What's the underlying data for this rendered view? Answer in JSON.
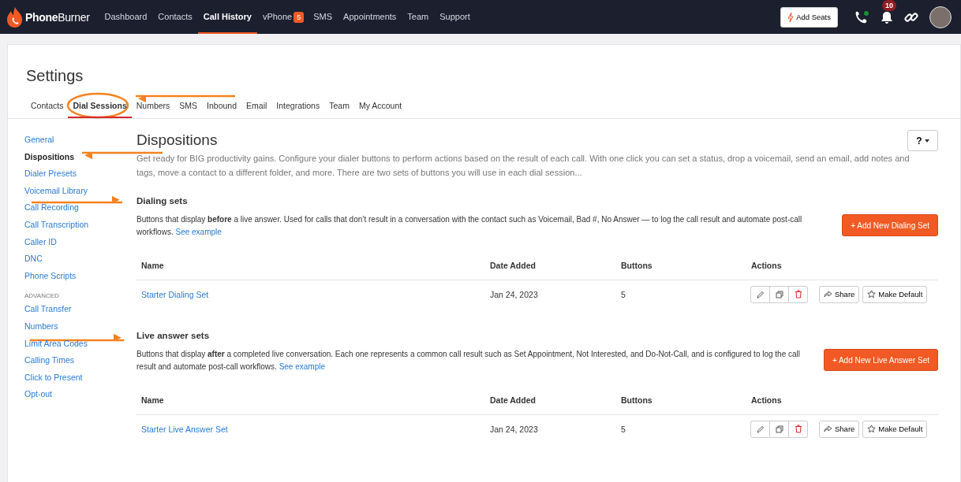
{
  "nav": {
    "logo": {
      "bold": "Phone",
      "light": "Burner"
    },
    "items": [
      {
        "label": "Dashboard",
        "selected": false
      },
      {
        "label": "Contacts",
        "selected": false
      },
      {
        "label": "Call History",
        "selected": true
      },
      {
        "label": "vPhone",
        "selected": false,
        "badge": "5"
      },
      {
        "label": "SMS",
        "selected": false
      },
      {
        "label": "Appointments",
        "selected": false
      },
      {
        "label": "Team",
        "selected": false
      },
      {
        "label": "Support",
        "selected": false
      }
    ],
    "add_seats": "Add Seats",
    "notifications": "10"
  },
  "settings": {
    "title": "Settings",
    "tabs": [
      {
        "label": "Contacts",
        "selected": false
      },
      {
        "label": "Dial Sessions",
        "selected": true
      },
      {
        "label": "Numbers",
        "selected": false
      },
      {
        "label": "SMS",
        "selected": false
      },
      {
        "label": "Inbound",
        "selected": false
      },
      {
        "label": "Email",
        "selected": false
      },
      {
        "label": "Integrations",
        "selected": false
      },
      {
        "label": "Team",
        "selected": false
      },
      {
        "label": "My Account",
        "selected": false
      }
    ]
  },
  "sidebar": {
    "groups": [
      {
        "items": [
          {
            "label": "General",
            "selected": false
          },
          {
            "label": "Dispositions",
            "selected": true
          },
          {
            "label": "Dialer Presets",
            "selected": false
          },
          {
            "label": "Voicemail Library",
            "selected": false
          },
          {
            "label": "Call Recording",
            "selected": false
          },
          {
            "label": "Call Transcription",
            "selected": false
          },
          {
            "label": "Caller ID",
            "selected": false
          },
          {
            "label": "DNC",
            "selected": false
          },
          {
            "label": "Phone Scripts",
            "selected": false
          }
        ]
      },
      {
        "heading": "ADVANCED",
        "items": [
          {
            "label": "Call Transfer",
            "selected": false
          },
          {
            "label": "Numbers",
            "selected": false
          },
          {
            "label": "Limit Area Codes",
            "selected": false
          },
          {
            "label": "Calling Times",
            "selected": false
          },
          {
            "label": "Click to Present",
            "selected": false
          },
          {
            "label": "Opt-out",
            "selected": false
          }
        ]
      }
    ]
  },
  "content": {
    "title": "Dispositions",
    "help": "?",
    "intro": "Get ready for BIG productivity gains. Configure your dialer buttons to perform actions based on the result of each call. With one click you can set a status, drop a voicemail, send an email, add notes and tags, move a contact to a different folder, and more. There are two sets of buttons you will use in each dial session...",
    "sections": [
      {
        "title": "Dialing sets",
        "description": "Buttons that display **before** a live answer. Used for calls that don’t result in a conversation with the contact such as Voicemail, Bad #, No Answer — to log the call result and automate post-call workflows.",
        "link": "See example",
        "button": "+ Add New Dialing Set",
        "columns": [
          "Name",
          "Date Added",
          "Buttons",
          "Actions"
        ],
        "rows": [
          {
            "name": "Starter Dialing Set",
            "date": "Jan 24, 2023",
            "buttons": "5",
            "share": "Share",
            "make_default": "Make Default"
          }
        ]
      },
      {
        "title": "Live answer sets",
        "description": "Buttons that display **after** a completed live conversation. Each one represents a common call result such as Set Appointment, Not Interested, and Do-Not-Call, and is configured to log the call result and automate post-call workflows.",
        "link": "See example",
        "button": "+ Add New Live Answer Set",
        "columns": [
          "Name",
          "Date Added",
          "Buttons",
          "Actions"
        ],
        "rows": [
          {
            "name": "Starter Live Answer Set",
            "date": "Jan 24, 2023",
            "buttons": "5",
            "share": "Share",
            "make_default": "Make Default"
          }
        ]
      }
    ]
  }
}
